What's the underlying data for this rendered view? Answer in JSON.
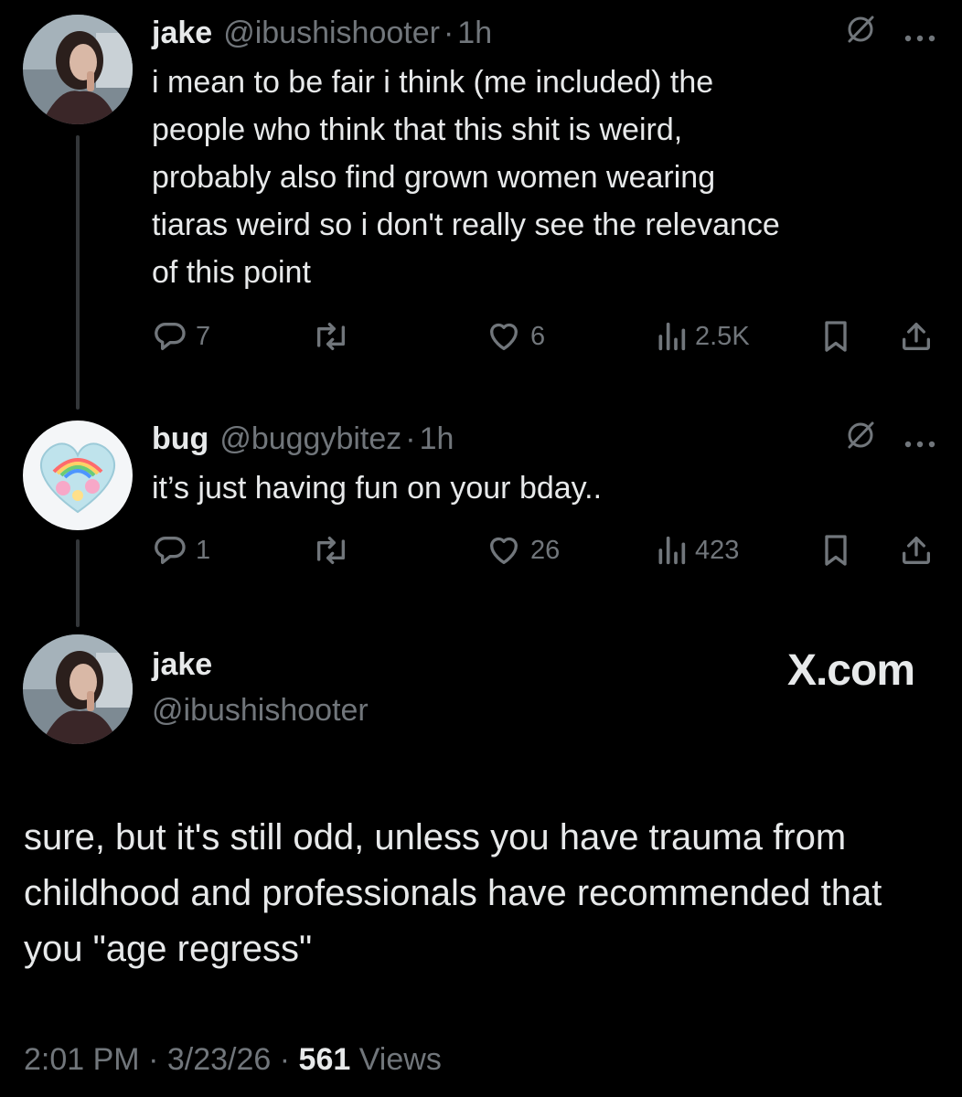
{
  "tweets": [
    {
      "name": "jake",
      "handle": "@ibushishooter",
      "separator": "·",
      "time": "1h",
      "text": "i mean to be fair i think (me included) the\npeople who think that this shit is weird,\nprobably also find grown women wearing\ntiaras weird so i don't really see the relevance\nof this point",
      "replies": "7",
      "likes": "6",
      "views": "2.5K"
    },
    {
      "name": "bug",
      "handle": "@buggybitez",
      "separator": "·",
      "time": "1h",
      "text": "it’s just having fun on your bday..",
      "replies": "1",
      "likes": "26",
      "views": "423"
    }
  ],
  "main_tweet": {
    "name": "jake",
    "handle": "@ibushishooter",
    "brand": "X.com",
    "text": "sure, but it's still odd, unless you have trauma from childhood and professionals have recommended that you \"age regress\"",
    "time": "2:01 PM",
    "date": "3/23/26",
    "separator": "·",
    "views_count": "561",
    "views_label": "Views"
  },
  "icons": [
    "grok-icon",
    "more-icon",
    "reply-icon",
    "retweet-icon",
    "like-icon",
    "views-icon",
    "bookmark-icon",
    "share-icon"
  ],
  "colors": {
    "background": "#000000",
    "text": "#e7e9ea",
    "muted": "#71767b",
    "thread_line": "#333639"
  }
}
